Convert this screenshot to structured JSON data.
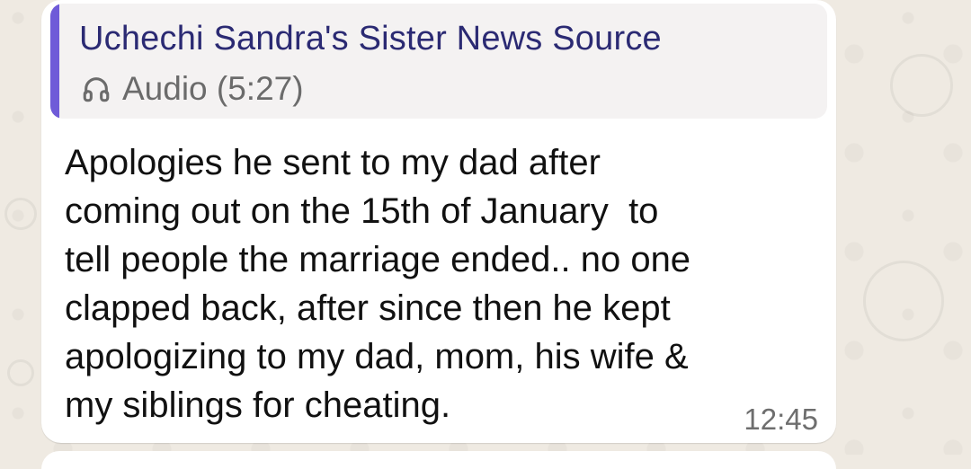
{
  "quoted_message": {
    "author": "Uchechi Sandra's Sister News Source",
    "media_icon": "headphones-icon",
    "media_label": "Audio (5:27)",
    "accent_color": "#6f5bd8",
    "author_color": "#2b2a73"
  },
  "message": {
    "text": "Apologies he sent to my dad after\ncoming out on the 15th of January  to\ntell people the marriage ended.. no one\nclapped back, after since then he kept\napologizing to my dad, mom, his wife &\nmy siblings for cheating.",
    "time": "12:45"
  },
  "colors": {
    "wallpaper": "#efeae2",
    "bubble": "#ffffff",
    "quote_background": "#f4f2f2"
  }
}
